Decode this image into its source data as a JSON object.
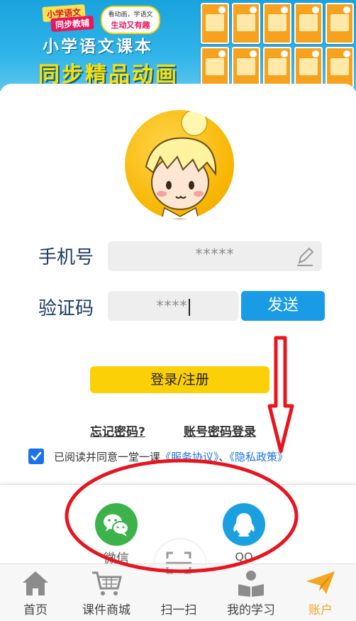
{
  "banner": {
    "tag_primary": "小学语文",
    "tag_secondary": "同步教辅",
    "bubble_line1": "看动画，学语文",
    "bubble_line2": "生动又有趣",
    "headline": "小学语文课本",
    "subheadline": "同步精品动画"
  },
  "login": {
    "phone_label": "手机号",
    "phone_value": "*****",
    "code_label": "验证码",
    "code_value": "****",
    "send_button": "发送",
    "login_button": "登录/注册",
    "forgot_password": "忘记密码?",
    "password_login": "账号密码登录",
    "agree_prefix": "已阅读并同意一堂一课",
    "service_agreement": "《服务协议》",
    "agree_separator": "、",
    "privacy_policy": "《隐私政策》"
  },
  "third_party": {
    "wechat_label": "微信",
    "qq_label": "QQ"
  },
  "tabbar": {
    "items": [
      {
        "label": "首页",
        "icon": "home-icon"
      },
      {
        "label": "课件商城",
        "icon": "cart-icon"
      },
      {
        "label": "扫一扫",
        "icon": "scan-icon"
      },
      {
        "label": "我的学习",
        "icon": "study-icon"
      },
      {
        "label": "账户",
        "icon": "paper-plane-icon"
      }
    ],
    "active_index": 4
  },
  "colors": {
    "accent_blue": "#1a9be6",
    "login_yellow": "#fcd006",
    "active_tab": "#f5a623",
    "annotation_red": "#e8141e",
    "wechat_green": "#3bb24a",
    "qq_blue": "#1aa0e0"
  }
}
